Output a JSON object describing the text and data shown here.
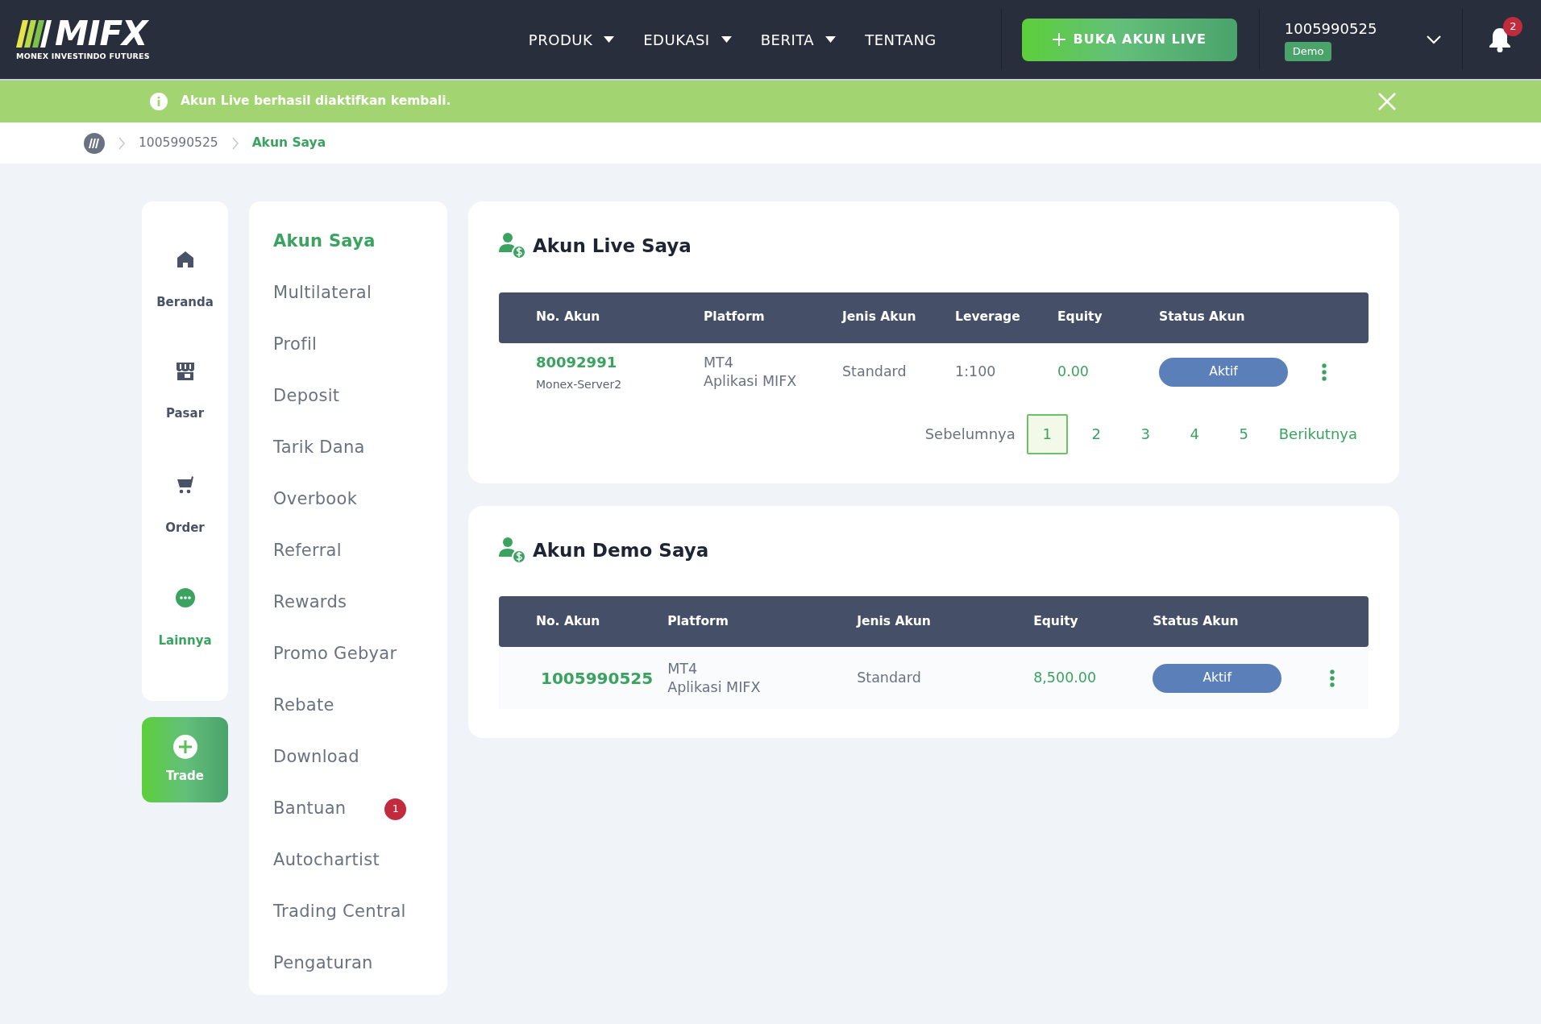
{
  "header": {
    "logo_text": "MIFX",
    "logo_subtitle": "MONEX INVESTINDO FUTURES",
    "nav": [
      {
        "label": "PRODUK",
        "dropdown": true
      },
      {
        "label": "EDUKASI",
        "dropdown": true
      },
      {
        "label": "BERITA",
        "dropdown": true
      },
      {
        "label": "TENTANG",
        "dropdown": false
      }
    ],
    "cta": "BUKA AKUN LIVE",
    "account_number": "1005990525",
    "account_badge": "Demo",
    "notification_count": "2"
  },
  "alert": {
    "message": "Akun Live berhasil diaktifkan kembali."
  },
  "breadcrumb": [
    "1005990525",
    "Akun Saya"
  ],
  "rail": [
    {
      "label": "Beranda",
      "selected": false
    },
    {
      "label": "Pasar",
      "selected": false
    },
    {
      "label": "Order",
      "selected": false
    },
    {
      "label": "Lainnya",
      "selected": true
    }
  ],
  "trade_button": "Trade",
  "menu": [
    {
      "label": "Akun Saya",
      "selected": true
    },
    {
      "label": "Multilateral",
      "selected": false
    },
    {
      "label": "Profil",
      "selected": false
    },
    {
      "label": "Deposit",
      "selected": false
    },
    {
      "label": "Tarik Dana",
      "selected": false
    },
    {
      "label": "Overbook",
      "selected": false
    },
    {
      "label": "Referral",
      "selected": false
    },
    {
      "label": "Rewards",
      "selected": false
    },
    {
      "label": "Promo Gebyar",
      "selected": false
    },
    {
      "label": "Rebate",
      "selected": false
    },
    {
      "label": "Download",
      "selected": false
    },
    {
      "label": "Bantuan",
      "selected": false,
      "badge": "1"
    },
    {
      "label": "Autochartist",
      "selected": false
    },
    {
      "label": "Trading Central",
      "selected": false
    },
    {
      "label": "Pengaturan",
      "selected": false
    }
  ],
  "sections": [
    {
      "title": "Akun Live Saya",
      "columns": [
        "No. Akun",
        "Platform",
        "Jenis Akun",
        "Leverage",
        "Equity",
        "Status Akun"
      ],
      "rows": [
        {
          "cells": [
            {
              "kind": "account",
              "text": "80092991",
              "sub": "Monex-Server2"
            },
            {
              "kind": "platform",
              "lines": [
                "MT4",
                "Aplikasi MIFX"
              ]
            },
            {
              "kind": "text",
              "text": "Standard"
            },
            {
              "kind": "text",
              "text": "1:100"
            },
            {
              "kind": "equity",
              "text": "0.00"
            },
            {
              "kind": "status",
              "text": "Aktif"
            }
          ]
        }
      ],
      "pagination": {
        "prev": "Sebelumnya",
        "next": "Berikutnya",
        "pages": [
          {
            "label": "1",
            "selected": true
          },
          {
            "label": "2",
            "selected": false
          },
          {
            "label": "3",
            "selected": false
          },
          {
            "label": "4",
            "selected": false
          },
          {
            "label": "5",
            "selected": false
          }
        ]
      }
    },
    {
      "title": "Akun Demo Saya",
      "columns": [
        "No. Akun",
        "Platform",
        "Jenis Akun",
        "Equity",
        "Status Akun"
      ],
      "rows": [
        {
          "cells": [
            {
              "kind": "account",
              "text": "1005990525"
            },
            {
              "kind": "platform",
              "lines": [
                "MT4",
                "Aplikasi MIFX"
              ]
            },
            {
              "kind": "text",
              "text": "Standard"
            },
            {
              "kind": "equity",
              "text": "8,500.00"
            },
            {
              "kind": "status",
              "text": "Aktif"
            }
          ]
        }
      ]
    }
  ]
}
